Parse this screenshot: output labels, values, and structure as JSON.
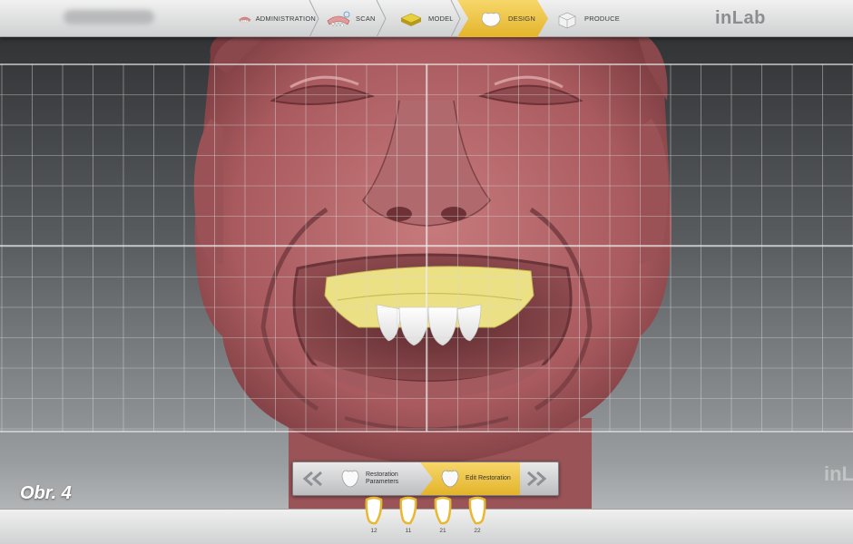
{
  "app": {
    "brand": "inLab",
    "figure_label": "Obr. 4",
    "watermark": "inL"
  },
  "workflow": {
    "active": "DESIGN",
    "steps": [
      {
        "label": "ADMINISTRATION",
        "icon": "denture-icon"
      },
      {
        "label": "SCAN",
        "icon": "scan-icon"
      },
      {
        "label": "MODEL",
        "icon": "model-icon"
      },
      {
        "label": "DESIGN",
        "icon": "crown-icon"
      },
      {
        "label": "PRODUCE",
        "icon": "milling-block-icon"
      }
    ]
  },
  "substeps": {
    "prev_icon": "double-chevron-left-icon",
    "next_icon": "double-chevron-right-icon",
    "items": [
      {
        "label_line1": "Restoration",
        "label_line2": "Parameters",
        "icon": "tooth-icon"
      },
      {
        "label_line1": "Edit Restoration",
        "label_line2": "",
        "icon": "tooth-icon"
      }
    ]
  },
  "teeth": [
    {
      "number": "12"
    },
    {
      "number": "11"
    },
    {
      "number": "21"
    },
    {
      "number": "22"
    }
  ],
  "colors": {
    "accent": "#e8b830",
    "face": "#b5676a",
    "restoration": "#ece084"
  }
}
